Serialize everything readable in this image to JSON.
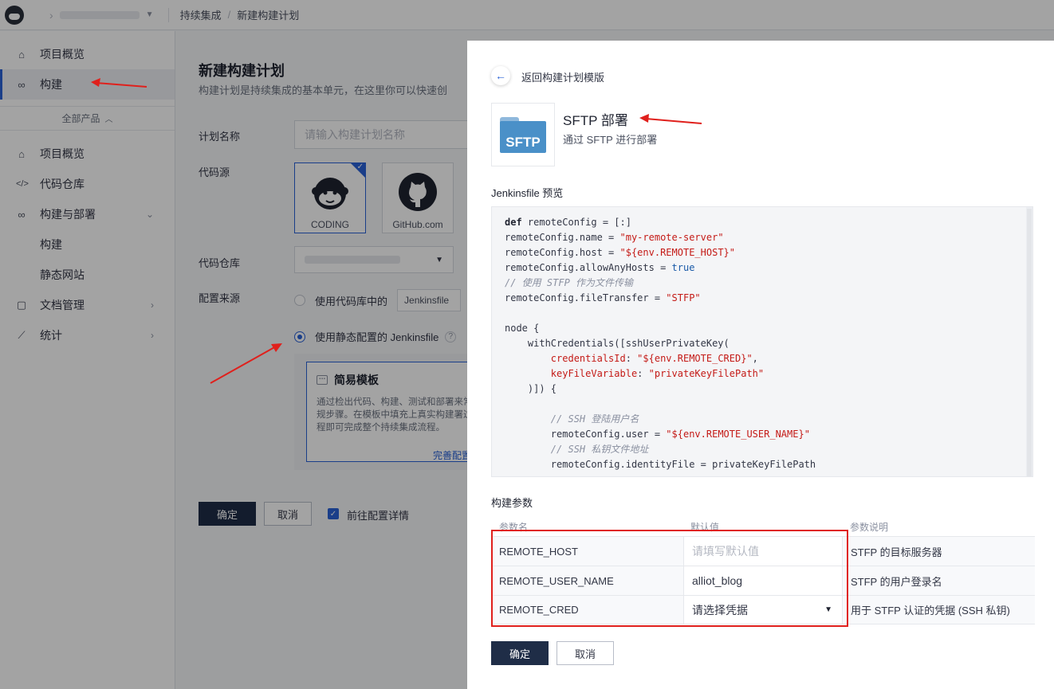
{
  "topbar": {
    "breadcrumb": [
      "持续集成",
      "新建构建计划"
    ]
  },
  "sidebar": {
    "top_items": [
      {
        "label": "项目概览",
        "icon": "home-icon"
      },
      {
        "label": "构建",
        "icon": "infinity-icon",
        "active": true
      }
    ],
    "all_products": "全部产品",
    "items": [
      {
        "label": "项目概览",
        "icon": "home-icon"
      },
      {
        "label": "代码仓库",
        "icon": "code-icon"
      },
      {
        "label": "构建与部署",
        "icon": "infinity-icon",
        "expanded": true
      },
      {
        "label": "构建",
        "sub": true
      },
      {
        "label": "静态网站",
        "sub": true
      },
      {
        "label": "文档管理",
        "icon": "document-icon"
      },
      {
        "label": "统计",
        "icon": "chart-icon"
      }
    ]
  },
  "form": {
    "title": "新建构建计划",
    "desc": "构建计划是持续集成的基本单元，在这里你可以快速创",
    "plan_name_label": "计划名称",
    "plan_name_placeholder": "请输入构建计划名称",
    "code_source_label": "代码源",
    "sources": [
      {
        "name": "CODING",
        "selected": true
      },
      {
        "name": "GitHub.com",
        "selected": false
      }
    ],
    "repo_label": "代码仓库",
    "config_source_label": "配置来源",
    "option_repo": "使用代码库中的",
    "option_repo_file": "Jenkinsfile",
    "option_static": "使用静态配置的 Jenkinsfile",
    "help_icon": "?",
    "template_title": "简易模板",
    "template_desc": "通过检出代码、构建、测试和部署来常规步骤。在模板中填充上真实构建署过程即可完成整个持续集成流程。",
    "template_link": "完善配置",
    "confirm": "确定",
    "cancel": "取消",
    "goto_detail": "前往配置详情"
  },
  "drawer": {
    "back": "返回构建计划模版",
    "icon_text": "SFTP",
    "template_name": "SFTP 部署",
    "template_desc": "通过 SFTP 进行部署",
    "preview_title": "Jenkinsfile 预览",
    "params_title": "构建参数",
    "param_headers": [
      "参数名",
      "默认值",
      "参数说明"
    ],
    "params": [
      {
        "name": "REMOTE_HOST",
        "value": "",
        "placeholder": "请填写默认值",
        "desc": "STFP 的目标服务器"
      },
      {
        "name": "REMOTE_USER_NAME",
        "value": "alliot_blog",
        "placeholder": "",
        "desc": "STFP 的用户登录名"
      },
      {
        "name": "REMOTE_CRED",
        "value": "请选择凭据",
        "placeholder": "",
        "desc": "用于 STFP 认证的凭据 (SSH 私钥)",
        "dropdown": true
      }
    ],
    "confirm": "确定",
    "cancel": "取消"
  },
  "colors": {
    "accent": "#2a62d6",
    "primary_button": "#1f2d47",
    "annotation_red": "#e0201c"
  }
}
